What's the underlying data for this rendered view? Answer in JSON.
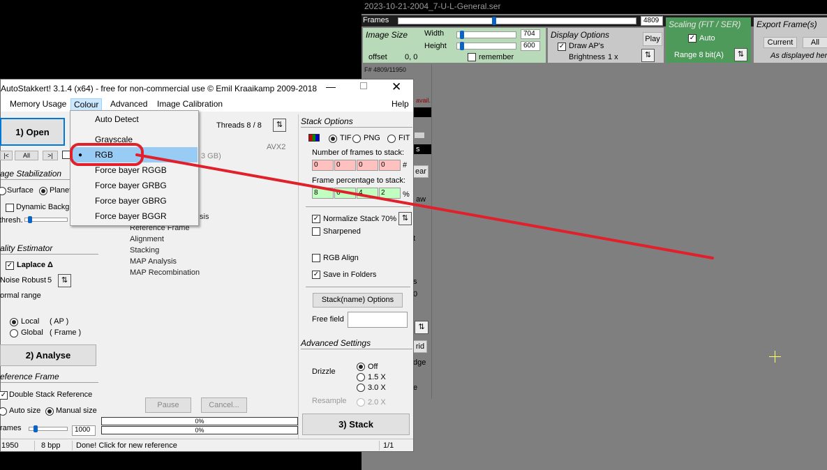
{
  "viewer": {
    "title": "2023-10-21-2004_7-U-L-General.ser",
    "frames_label": "Frames",
    "frames_value": "4809",
    "frames_fraction": 0.4,
    "image_size": {
      "title": "Image Size",
      "width_label": "Width",
      "width_value": "704",
      "height_label": "Height",
      "height_value": "600",
      "offset_label": "offset",
      "offset_value": "0, 0",
      "remember_label": "remember"
    },
    "display_options": {
      "title": "Display Options",
      "play_label": "Play",
      "draw_aps_label": "Draw AP's",
      "brightness_label": "Brightness",
      "brightness_value": "1 x"
    },
    "scaling": {
      "title": "Scaling (FIT / SER)",
      "auto_label": "Auto",
      "range_label": "Range 8 bit(A)"
    },
    "export": {
      "title": "Export Frame(s)",
      "current_label": "Current",
      "all_label": "All",
      "note": "As displayed her"
    },
    "frame_counter": "F# 4809/11950",
    "partial_labels": {
      "avail": "avail.",
      "s": "s",
      "ear": "ear",
      "aw": "aw",
      "t": "t",
      "s2": "s",
      "o": "0",
      "rid": "rid",
      "dge": "dge",
      "e": "e"
    }
  },
  "as": {
    "title": "AutoStakkert! 3.1.4 (x64) - free for non-commercial use © Emil Kraaikamp 2009-2018",
    "menu": [
      "Memory Usage",
      "Colour",
      "Advanced",
      "Image Calibration",
      "Help"
    ],
    "open_label": "1) Open",
    "nav": [
      "|<",
      "All",
      ">|"
    ],
    "threads_label": "Threads 8 / 8",
    "avx_label": "AVX2",
    "mem_partial": "3 GB)",
    "image_stabilization": {
      "title": "age Stabilization",
      "surface_label": "Surface",
      "planet_label": "Planet",
      "dynamic_bg_label": "Dynamic Backgr",
      "thresh_label": "thresh."
    },
    "quality": {
      "title": "ality Estimator",
      "laplace_label": "Laplace Δ",
      "noise_label": "Noise Robust",
      "noise_value": "5",
      "normal_range_label": "ormal range",
      "local_label": "Local",
      "local_suffix": "( AP )",
      "global_label": "Global",
      "global_suffix": "( Frame )"
    },
    "analyse_label": "2) Analyse",
    "reference": {
      "title": "eference Frame",
      "double_stack_label": "Double Stack Reference",
      "auto_size_label": "Auto size",
      "manual_size_label": "Manual size",
      "frames_label": "rames",
      "frames_value": "1000"
    },
    "stages": [
      "sis",
      "Reference Frame",
      "Alignment",
      "Stacking",
      "MAP Analysis",
      "MAP Recombination"
    ],
    "pause_label": "Pause",
    "cancel_label": "Cancel...",
    "progress1": "0%",
    "progress2": "0%",
    "stack_options": {
      "title": "Stack Options",
      "tif_label": "TIF",
      "png_label": "PNG",
      "fit_label": "FIT",
      "num_frames_label": "Number of frames to stack:",
      "num_frames": [
        "0",
        "0",
        "0",
        "0"
      ],
      "num_suffix": "#",
      "pct_label": "Frame percentage to stack:",
      "pct": [
        "8",
        "6",
        "4",
        "2"
      ],
      "pct_suffix": "%",
      "normalize_label": "Normalize Stack 70%",
      "sharpened_label": "Sharpened",
      "rgb_align_label": "RGB Align",
      "save_folders_label": "Save in Folders",
      "stackname_label": "Stack(name) Options",
      "free_field_label": "Free field",
      "free_field_value": ""
    },
    "advanced": {
      "title": "Advanced Settings",
      "drizzle_label": "Drizzle",
      "off_label": "Off",
      "x15_label": "1.5 X",
      "x30_label": "3.0 X",
      "resample_label": "Resample",
      "x20_label": "2.0 X"
    },
    "stack_label": "3) Stack",
    "status": {
      "frames": "1950",
      "bpp": "8 bpp",
      "message": "Done! Click for new reference",
      "page": "1/1"
    }
  },
  "colour_menu": {
    "items": [
      "Auto Detect",
      "Grayscale",
      "RGB",
      "Force bayer RGGB",
      "Force bayer GRBG",
      "Force bayer GBRG",
      "Force bayer BGGR"
    ],
    "selected": "RGB"
  },
  "colors": {
    "annotation_red": "#e0202a",
    "highlight_blue": "#99ccf5",
    "viewer_gray": "#7f7f7f"
  }
}
